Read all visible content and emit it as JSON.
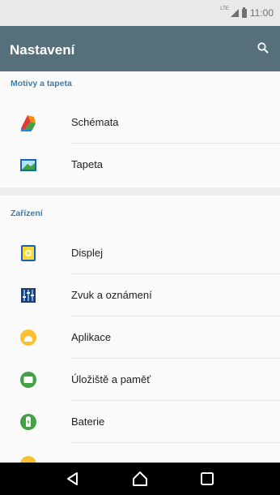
{
  "status_bar": {
    "network_type": "LTE",
    "time": "11:00"
  },
  "app_bar": {
    "title": "Nastavení",
    "search_icon": "search-icon"
  },
  "sections": [
    {
      "header": "Motivy a tapeta",
      "items": [
        {
          "label": "Schémata",
          "icon": "themes-icon"
        },
        {
          "label": "Tapeta",
          "icon": "wallpaper-icon"
        }
      ]
    },
    {
      "header": "Zařízení",
      "items": [
        {
          "label": "Displej",
          "icon": "display-icon"
        },
        {
          "label": "Zvuk a oznámení",
          "icon": "sound-icon"
        },
        {
          "label": "Aplikace",
          "icon": "apps-icon"
        },
        {
          "label": "Úložiště a paměť",
          "icon": "storage-icon"
        },
        {
          "label": "Baterie",
          "icon": "battery-icon"
        }
      ]
    }
  ],
  "nav_bar": {
    "icons": [
      "back-icon",
      "home-icon",
      "recents-icon"
    ]
  },
  "colors": {
    "app_bar": "#556f7b",
    "section_header": "#3f7ca5",
    "nav_bar": "#000000"
  }
}
